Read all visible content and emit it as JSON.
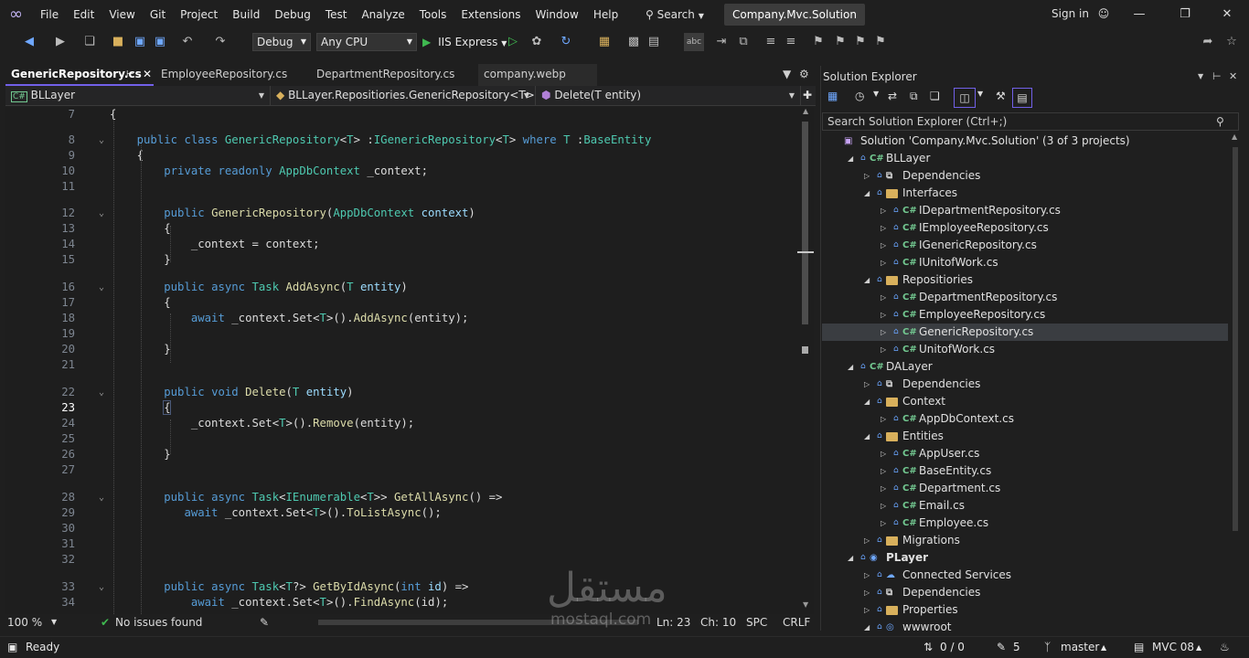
{
  "menu": [
    "File",
    "Edit",
    "View",
    "Git",
    "Project",
    "Build",
    "Debug",
    "Test",
    "Analyze",
    "Tools",
    "Extensions",
    "Window",
    "Help"
  ],
  "search_label": "Search",
  "solution_name": "Company.Mvc.Solution",
  "signin_label": "Sign in",
  "toolbar": {
    "config": "Debug",
    "platform": "Any CPU",
    "run_target": "IIS Express"
  },
  "tabs": [
    {
      "label": "GenericRepository.cs",
      "active": true
    },
    {
      "label": "EmployeeRepository.cs",
      "active": false
    },
    {
      "label": "DepartmentRepository.cs",
      "active": false
    },
    {
      "label": "company.webp",
      "active": false
    }
  ],
  "navbar": {
    "project": "BLLayer",
    "type": "BLLayer.Repositiories.GenericRepository<T>",
    "member": "Delete(T entity)"
  },
  "code_lines": [
    {
      "n": "7",
      "t": "{"
    },
    {
      "n": "8",
      "t": "    public class GenericRepository<T> :IGenericRepository<T> where T :BaseEntity"
    },
    {
      "n": "9",
      "t": "    {"
    },
    {
      "n": "10",
      "t": "        private readonly AppDbContext _context;"
    },
    {
      "n": "11",
      "t": ""
    },
    {
      "n": "12",
      "t": "        public GenericRepository(AppDbContext context)"
    },
    {
      "n": "13",
      "t": "        {"
    },
    {
      "n": "14",
      "t": "            _context = context;"
    },
    {
      "n": "15",
      "t": "        }"
    },
    {
      "n": "16",
      "t": "        public async Task AddAsync(T entity)"
    },
    {
      "n": "17",
      "t": "        {"
    },
    {
      "n": "18",
      "t": "            await _context.Set<T>().AddAsync(entity);"
    },
    {
      "n": "19",
      "t": ""
    },
    {
      "n": "20",
      "t": "        }"
    },
    {
      "n": "21",
      "t": ""
    },
    {
      "n": "22",
      "t": "        public void Delete(T entity)"
    },
    {
      "n": "23",
      "t": "        {"
    },
    {
      "n": "24",
      "t": "            _context.Set<T>().Remove(entity);"
    },
    {
      "n": "25",
      "t": ""
    },
    {
      "n": "26",
      "t": "        }"
    },
    {
      "n": "27",
      "t": ""
    },
    {
      "n": "28",
      "t": "        public async Task<IEnumerable<T>> GetAllAsync() =>"
    },
    {
      "n": "29",
      "t": "           await _context.Set<T>().ToListAsync();"
    },
    {
      "n": "30",
      "t": ""
    },
    {
      "n": "31",
      "t": ""
    },
    {
      "n": "32",
      "t": ""
    },
    {
      "n": "33",
      "t": "        public async Task<T?> GetByIdAsync(int id) =>"
    },
    {
      "n": "34",
      "t": "            await _context.Set<T>().FindAsync(id);"
    }
  ],
  "current_line": "23",
  "solution_explorer": {
    "title": "Solution Explorer",
    "search_placeholder": "Search Solution Explorer (Ctrl+;)",
    "items": [
      {
        "label": "Solution 'Company.Mvc.Solution' (3 of 3 projects)",
        "depth": 0,
        "icon": "solution-icon",
        "arrow": "",
        "bold": false
      },
      {
        "label": "BLLayer",
        "depth": 1,
        "icon": "csproj-icon",
        "arrow": "expanded",
        "bold": false
      },
      {
        "label": "Dependencies",
        "depth": 2,
        "icon": "dependencies-icon",
        "arrow": "collapsed",
        "bold": false
      },
      {
        "label": "Interfaces",
        "depth": 2,
        "icon": "folder-icon",
        "arrow": "expanded",
        "bold": false
      },
      {
        "label": "IDepartmentRepository.cs",
        "depth": 3,
        "icon": "csharp-file-icon",
        "arrow": "collapsed",
        "bold": false
      },
      {
        "label": "IEmployeeRepository.cs",
        "depth": 3,
        "icon": "csharp-file-icon",
        "arrow": "collapsed",
        "bold": false
      },
      {
        "label": "IGenericRepository.cs",
        "depth": 3,
        "icon": "csharp-file-icon",
        "arrow": "collapsed",
        "bold": false
      },
      {
        "label": "IUnitofWork.cs",
        "depth": 3,
        "icon": "csharp-file-icon",
        "arrow": "collapsed",
        "bold": false
      },
      {
        "label": "Repositiories",
        "depth": 2,
        "icon": "folder-icon",
        "arrow": "expanded",
        "bold": false
      },
      {
        "label": "DepartmentRepository.cs",
        "depth": 3,
        "icon": "csharp-file-icon",
        "arrow": "collapsed",
        "bold": false
      },
      {
        "label": "EmployeeRepository.cs",
        "depth": 3,
        "icon": "csharp-file-icon",
        "arrow": "collapsed",
        "bold": false
      },
      {
        "label": "GenericRepository.cs",
        "depth": 3,
        "icon": "csharp-file-icon",
        "arrow": "collapsed",
        "bold": false,
        "selected": true
      },
      {
        "label": "UnitofWork.cs",
        "depth": 3,
        "icon": "csharp-file-icon",
        "arrow": "collapsed",
        "bold": false
      },
      {
        "label": "DALayer",
        "depth": 1,
        "icon": "csproj-icon",
        "arrow": "expanded",
        "bold": false
      },
      {
        "label": "Dependencies",
        "depth": 2,
        "icon": "dependencies-icon",
        "arrow": "collapsed",
        "bold": false
      },
      {
        "label": "Context",
        "depth": 2,
        "icon": "folder-icon",
        "arrow": "expanded",
        "bold": false
      },
      {
        "label": "AppDbContext.cs",
        "depth": 3,
        "icon": "csharp-file-icon",
        "arrow": "collapsed",
        "bold": false
      },
      {
        "label": "Entities",
        "depth": 2,
        "icon": "folder-icon",
        "arrow": "expanded",
        "bold": false
      },
      {
        "label": "AppUser.cs",
        "depth": 3,
        "icon": "csharp-file-icon",
        "arrow": "collapsed",
        "bold": false
      },
      {
        "label": "BaseEntity.cs",
        "depth": 3,
        "icon": "csharp-file-icon",
        "arrow": "collapsed",
        "bold": false
      },
      {
        "label": "Department.cs",
        "depth": 3,
        "icon": "csharp-file-icon",
        "arrow": "collapsed",
        "bold": false
      },
      {
        "label": "Email.cs",
        "depth": 3,
        "icon": "csharp-file-icon",
        "arrow": "collapsed",
        "bold": false
      },
      {
        "label": "Employee.cs",
        "depth": 3,
        "icon": "csharp-file-icon",
        "arrow": "collapsed",
        "bold": false
      },
      {
        "label": "Migrations",
        "depth": 2,
        "icon": "folder-icon",
        "arrow": "collapsed",
        "bold": false
      },
      {
        "label": "PLayer",
        "depth": 1,
        "icon": "web-project-icon",
        "arrow": "expanded",
        "bold": true
      },
      {
        "label": "Connected Services",
        "depth": 2,
        "icon": "connected-services-icon",
        "arrow": "collapsed",
        "bold": false
      },
      {
        "label": "Dependencies",
        "depth": 2,
        "icon": "dependencies-icon",
        "arrow": "collapsed",
        "bold": false
      },
      {
        "label": "Properties",
        "depth": 2,
        "icon": "folder-icon",
        "arrow": "collapsed",
        "bold": false
      },
      {
        "label": "wwwroot",
        "depth": 2,
        "icon": "globe-icon",
        "arrow": "expanded",
        "bold": false
      }
    ]
  },
  "editor_status": {
    "zoom": "100 %",
    "issues": "No issues found",
    "line": "Ln: 23",
    "col": "Ch: 10",
    "spc": "SPC",
    "eol": "CRLF"
  },
  "status_bar": {
    "ready": "Ready",
    "sync": "0 / 0",
    "edits": "5",
    "branch": "master",
    "repo": "MVC 08"
  },
  "watermark": {
    "arabic": "مستقل",
    "latin": "mostaql.com"
  },
  "colors": {
    "accent": "#7160e8",
    "keyword": "#569cd6",
    "type": "#4ec9b0",
    "method": "#dcdcaa",
    "param": "#9cdcfe"
  }
}
